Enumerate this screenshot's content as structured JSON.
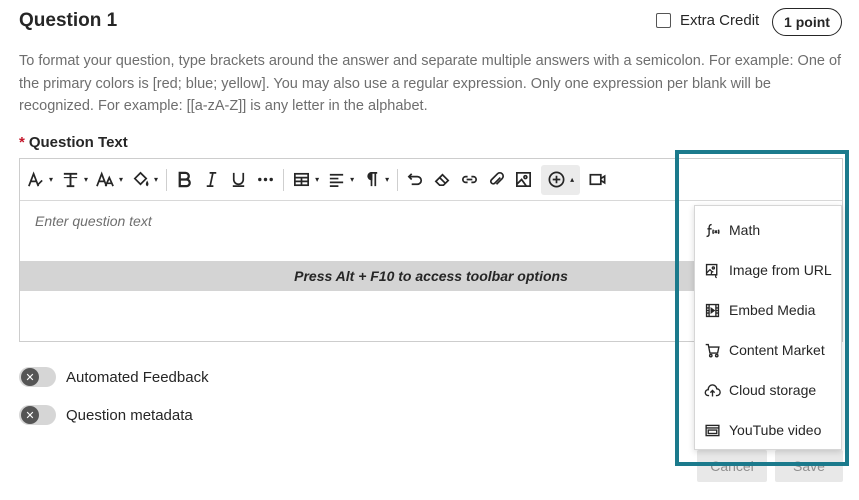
{
  "header": {
    "title": "Question 1",
    "extra_credit_label": "Extra Credit",
    "points_label": "1 point"
  },
  "instructions": "To format your question, type brackets around the answer and separate multiple answers with a semicolon. For example: One of the primary colors is [red; blue; yellow]. You may also use a regular expression. Only one expression per blank will be recognized. For example: [[a-zA-Z]] is any letter in the alphabet.",
  "question_text": {
    "required_mark": "*",
    "label": "Question Text",
    "placeholder": "Enter question text",
    "toolbar_hint": "Press Alt + F10 to access toolbar options"
  },
  "toolbar": {
    "caret": "▾",
    "insert_caret": "▴",
    "icons": [
      "text-style-icon",
      "font-family-icon",
      "font-size-icon",
      "fill-color-icon",
      "bold-icon",
      "italic-icon",
      "underline-icon",
      "more-icon",
      "table-icon",
      "align-icon",
      "paragraph-icon",
      "undo-icon",
      "eraser-icon",
      "link-icon",
      "attachment-icon",
      "image-icon",
      "insert-content-icon",
      "video-icon"
    ]
  },
  "insert_menu": {
    "items": [
      {
        "label": "Math",
        "icon": "math-icon"
      },
      {
        "label": "Image from URL",
        "icon": "image-url-icon"
      },
      {
        "label": "Embed Media",
        "icon": "embed-media-icon"
      },
      {
        "label": "Content Market",
        "icon": "cart-icon"
      },
      {
        "label": "Cloud storage",
        "icon": "cloud-upload-icon"
      },
      {
        "label": "YouTube video",
        "icon": "youtube-icon"
      }
    ]
  },
  "toggles": [
    {
      "label": "Automated Feedback",
      "knob": "✕"
    },
    {
      "label": "Question metadata",
      "knob": "✕"
    }
  ],
  "footer": {
    "cancel_label": "Cancel",
    "save_label": "Save"
  },
  "colors": {
    "highlight": "#1b7a8c",
    "required": "#c4162a"
  }
}
